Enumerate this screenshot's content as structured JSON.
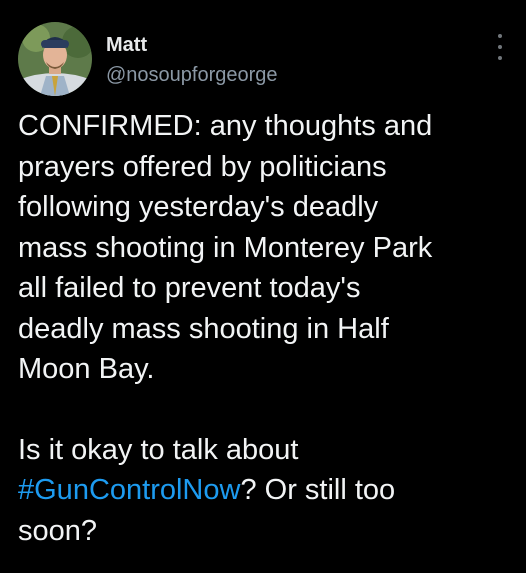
{
  "tweet": {
    "author": {
      "display_name": "Matt",
      "handle": "@nosoupforgeorge",
      "avatar_icon": "profile-photo"
    },
    "more_icon": "vertical-ellipsis-icon",
    "paragraph1_lines": [
      "CONFIRMED: any thoughts and",
      "prayers offered by politicians",
      "following yesterday's deadly",
      "mass shooting in Monterey Park",
      "all failed to prevent today's",
      "deadly mass shooting in Half",
      "Moon Bay."
    ],
    "paragraph2": {
      "line1": "Is it okay to talk about",
      "hashtag": "#GunControlNow",
      "line2_rest": "? Or still too",
      "line3": "soon?"
    },
    "colors": {
      "background": "#000000",
      "text": "#e7e9ea",
      "secondary": "#8b98a5",
      "link": "#1d9bf0"
    }
  }
}
